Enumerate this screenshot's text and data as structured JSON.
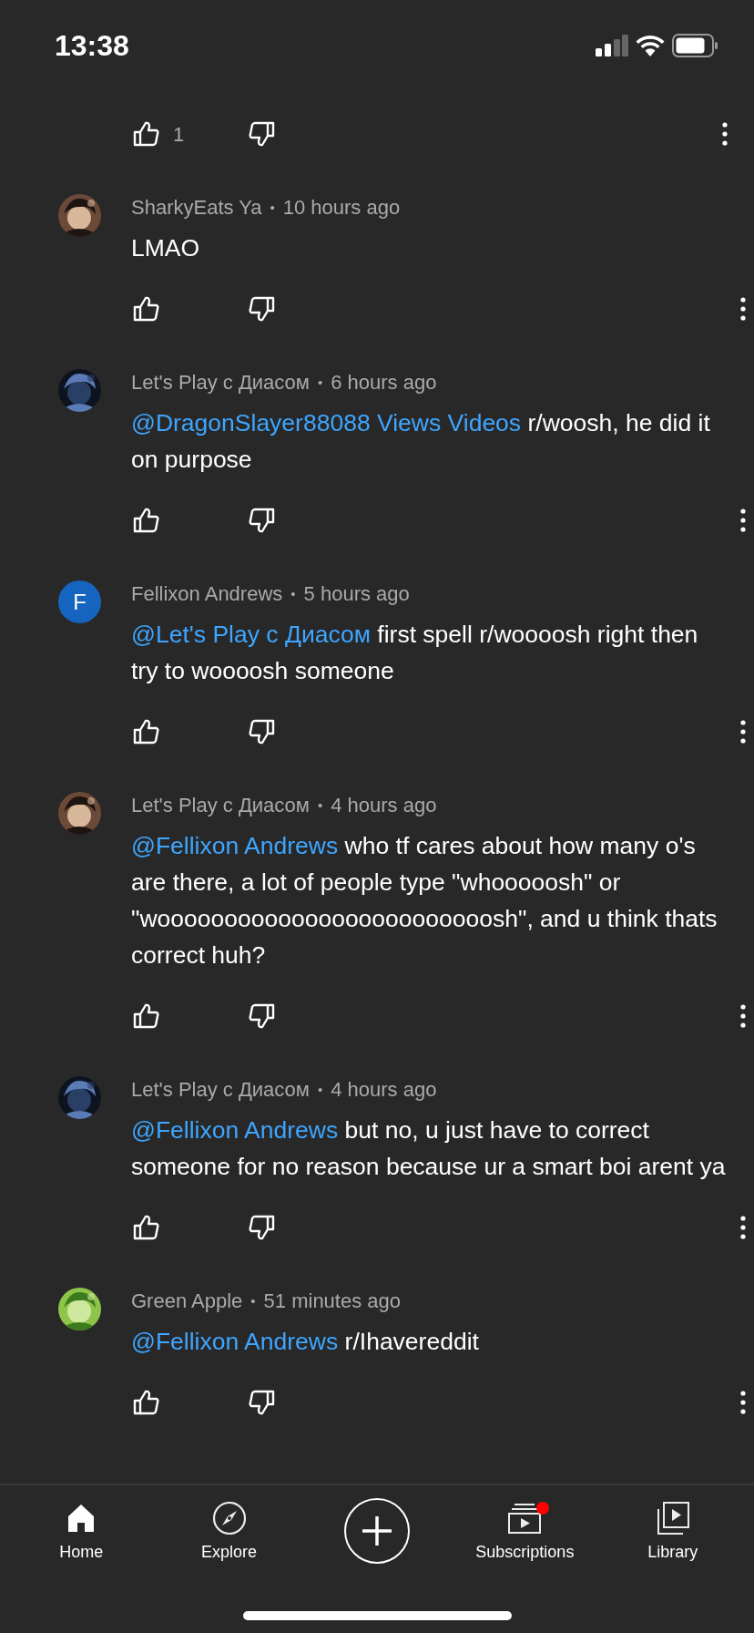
{
  "status_bar": {
    "time": "13:38"
  },
  "first_comment_actions": {
    "likes": "1"
  },
  "meta_separator": "•",
  "comments": [
    {
      "author": "SharkyEats Ya",
      "time": "10 hours ago",
      "text": "LMAO"
    },
    {
      "author": "Let's Play с Диасом",
      "time": "6 hours ago",
      "mention": "@DragonSlayer88088 Views Videos",
      "text": "r/woosh, he did it on purpose"
    },
    {
      "avatar": {
        "kind": "letter",
        "letter": "F"
      },
      "author": "Fellixon Andrews",
      "time": "5 hours ago",
      "mention": "@Let's Play с Диасом",
      "text": "first spell r/woooosh right then try to woooosh someone"
    },
    {
      "author": "Let's Play с Диасом",
      "time": "4 hours ago",
      "mention": "@Fellixon Andrews",
      "text": "who tf cares about how many o's are there, a lot of people type \"whooooosh\" or \"wooooooooooooooooooooooooosh\", and u think thats correct huh?"
    },
    {
      "author": "Let's Play с Диасом",
      "time": "4 hours ago",
      "mention": "@Fellixon Andrews",
      "text": "but no, u just have to correct someone for no reason because ur a smart boi arent ya"
    },
    {
      "author": "Green Apple",
      "time": "51 minutes ago",
      "mention": "@Fellixon Andrews",
      "text": "r/Ihavereddit"
    }
  ],
  "bottom_nav": [
    {
      "kind": "home",
      "label": "Home",
      "selected": true
    },
    {
      "kind": "explore",
      "label": "Explore",
      "selected": false
    },
    {
      "kind": "create",
      "selected": false
    },
    {
      "kind": "subscriptions",
      "label": "Subscriptions",
      "selected": false,
      "badge": true
    },
    {
      "kind": "library",
      "label": "Library",
      "selected": false
    }
  ]
}
